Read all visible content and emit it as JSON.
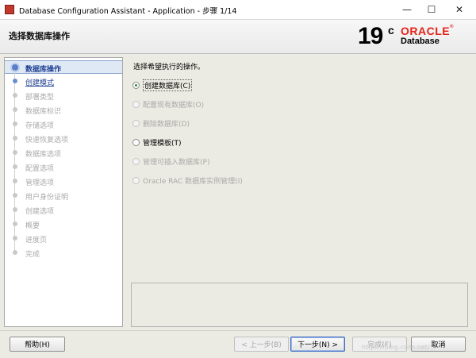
{
  "window": {
    "title": "Database Configuration Assistant - Application - 步骤 1/14",
    "minimize_glyph": "—",
    "maximize_glyph": "☐",
    "close_glyph": "✕"
  },
  "header": {
    "step_title": "选择数据库操作",
    "logo": {
      "version": "19",
      "superscript": "c",
      "brand": "ORACLE",
      "registered": "®",
      "product": "Database",
      "brand_color": "#e2231a"
    }
  },
  "nav": {
    "items": [
      {
        "label": "数据库操作",
        "state": "current"
      },
      {
        "label": "创建模式",
        "state": "link"
      },
      {
        "label": "部署类型",
        "state": "disabled"
      },
      {
        "label": "数据库标识",
        "state": "disabled"
      },
      {
        "label": "存储选项",
        "state": "disabled"
      },
      {
        "label": "快速恢复选项",
        "state": "disabled"
      },
      {
        "label": "数据库选项",
        "state": "disabled"
      },
      {
        "label": "配置选项",
        "state": "disabled"
      },
      {
        "label": "管理选项",
        "state": "disabled"
      },
      {
        "label": "用户身份证明",
        "state": "disabled"
      },
      {
        "label": "创建选项",
        "state": "disabled"
      },
      {
        "label": "概要",
        "state": "disabled"
      },
      {
        "label": "进度页",
        "state": "disabled"
      },
      {
        "label": "完成",
        "state": "disabled"
      }
    ],
    "current_color": "#1d3f91"
  },
  "content": {
    "prompt": "选择希望执行的操作。",
    "options": [
      {
        "label": "创建数据库(C)",
        "checked": true,
        "enabled": true
      },
      {
        "label": "配置现有数据库(O)",
        "checked": false,
        "enabled": false
      },
      {
        "label": "删除数据库(D)",
        "checked": false,
        "enabled": false
      },
      {
        "label": "管理模板(T)",
        "checked": false,
        "enabled": true
      },
      {
        "label": "管理可插入数据库(P)",
        "checked": false,
        "enabled": false
      },
      {
        "label": "Oracle RAC 数据库实例管理(I)",
        "checked": false,
        "enabled": false
      }
    ]
  },
  "footer": {
    "help": "帮助(H)",
    "back": "< 上一步(B)",
    "next": "下一步(N) >",
    "finish": "完成(F)",
    "cancel": "取消"
  },
  "watermark": "https://blog.csdn.net/..."
}
